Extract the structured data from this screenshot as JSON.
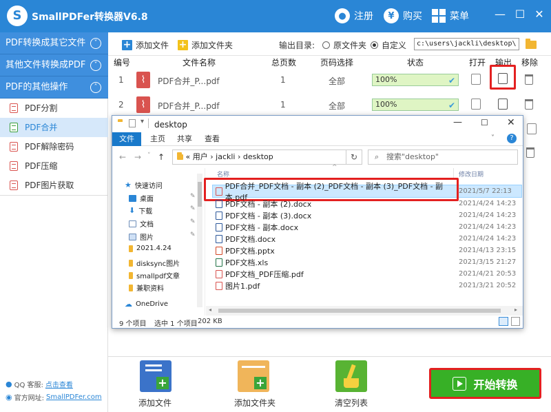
{
  "app": {
    "title": "SmallPDFer转换器V6.8",
    "register": "注册",
    "buy": "购买",
    "menu": "菜单"
  },
  "sidebar": {
    "categories": [
      {
        "label": "PDF转换成其它文件"
      },
      {
        "label": "其他文件转换成PDF"
      },
      {
        "label": "PDF的其他操作"
      }
    ],
    "items": [
      {
        "label": "PDF分割"
      },
      {
        "label": "PDF合并"
      },
      {
        "label": "PDF解除密码"
      },
      {
        "label": "PDF压缩"
      },
      {
        "label": "PDF图片获取"
      }
    ],
    "qq_label": "QQ 客服:",
    "qq_link": "点击查看",
    "site_label": "官方网址:",
    "site_link": "SmallPDFer.com"
  },
  "toolbar": {
    "add_file": "添加文件",
    "add_folder": "添加文件夹",
    "output_dir_label": "输出目录:",
    "opt_source": "原文件夹",
    "opt_custom": "自定义",
    "path": "c:\\users\\jackli\\desktop\\"
  },
  "table": {
    "headers": [
      "编号",
      "文件名称",
      "总页数",
      "页码选择",
      "状态",
      "打开",
      "输出",
      "移除"
    ],
    "rows": [
      {
        "num": "1",
        "name": "PDF合并_P...pdf",
        "pages": "1",
        "range": "全部",
        "status": "100%",
        "progress": 1.0
      },
      {
        "num": "2",
        "name": "PDF合并_P...pdf",
        "pages": "1",
        "range": "全部",
        "status": "100%",
        "progress": 1.0
      }
    ]
  },
  "explorer": {
    "title": "desktop",
    "tabs": [
      "文件",
      "主页",
      "共享",
      "查看"
    ],
    "address": [
      "«",
      "用户",
      "jackli",
      "desktop"
    ],
    "search_placeholder": "搜索\"desktop\"",
    "col_name": "名称",
    "col_date": "修改日期",
    "nav": [
      {
        "label": "快速访问"
      },
      {
        "label": "桌面"
      },
      {
        "label": "下载"
      },
      {
        "label": "文档"
      },
      {
        "label": "图片"
      },
      {
        "label": "2021.4.24"
      },
      {
        "label": "disksync图片"
      },
      {
        "label": "smallpdf文章"
      },
      {
        "label": "兼职资料"
      },
      {
        "label": "OneDrive"
      }
    ],
    "files": [
      {
        "name": "PDF合并_PDF文档 - 副本 (2)_PDF文档 - 副本 (3)_PDF文档 - 副本.pdf",
        "date": "2021/5/7 22:13",
        "kind": "pdf"
      },
      {
        "name": "PDF文档 - 副本 (2).docx",
        "date": "2021/4/24 14:23",
        "kind": "docx"
      },
      {
        "name": "PDF文档 - 副本 (3).docx",
        "date": "2021/4/24 14:23",
        "kind": "docx"
      },
      {
        "name": "PDF文档 - 副本.docx",
        "date": "2021/4/24 14:23",
        "kind": "docx"
      },
      {
        "name": "PDF文档.docx",
        "date": "2021/4/24 14:23",
        "kind": "docx"
      },
      {
        "name": "PDF文档.pptx",
        "date": "2021/4/13 23:15",
        "kind": "pptx"
      },
      {
        "name": "PDF文档.xls",
        "date": "2021/3/15 21:27",
        "kind": "xls"
      },
      {
        "name": "PDF文档_PDF压缩.pdf",
        "date": "2021/4/21 20:53",
        "kind": "pdf"
      },
      {
        "name": "图片1.pdf",
        "date": "2021/3/21 20:52",
        "kind": "pdf"
      }
    ],
    "status_count": "9 个项目",
    "status_selected": "选中 1 个项目",
    "status_size": "202 KB"
  },
  "bottom": {
    "add_file": "添加文件",
    "add_folder": "添加文件夹",
    "clear": "清空列表",
    "start": "开始转换"
  },
  "colors": {
    "brand": "#2a86d6",
    "start_green": "#37b026",
    "highlight_red": "#e32020"
  }
}
